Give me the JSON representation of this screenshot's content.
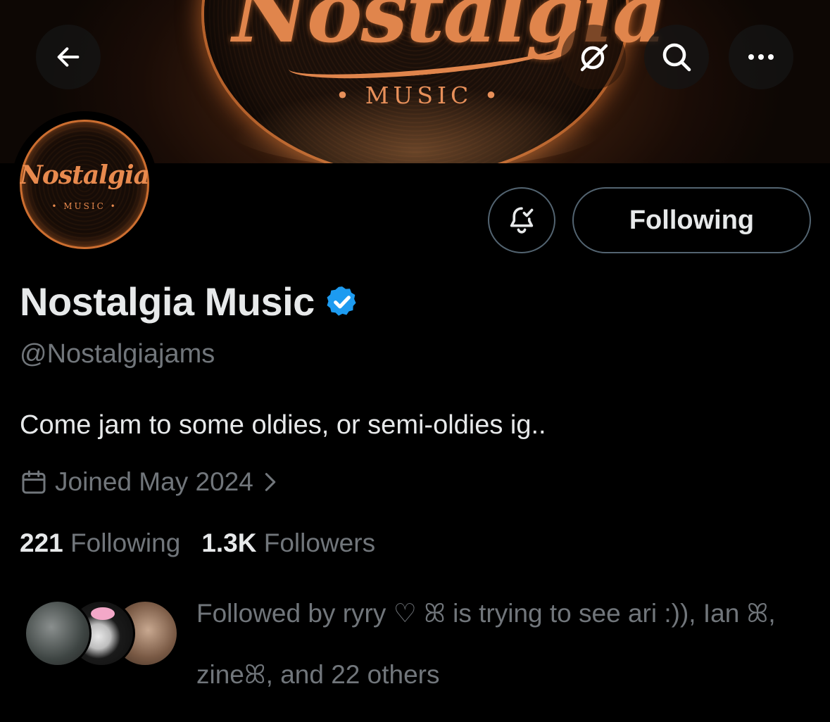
{
  "banner": {
    "logo_text": "Nostalgia",
    "sub_text": "• MUSIC •"
  },
  "nav": {
    "back_icon": "arrow-left-icon",
    "grok_icon": "grok-icon",
    "search_icon": "search-icon",
    "more_icon": "more-icon"
  },
  "avatar": {
    "logo_text": "Nostalgia",
    "sub_text": "• MUSIC •"
  },
  "actions": {
    "notify_icon": "bell-check-icon",
    "follow_label": "Following"
  },
  "profile": {
    "display_name": "Nostalgia Music",
    "verified_icon": "verified-badge-icon",
    "verified_color": "#1d9bf0",
    "handle": "@Nostalgiajams",
    "bio": "Come jam to some oldies, or semi-oldies ig..",
    "joined": "Joined May 2024",
    "joined_icon": "calendar-icon"
  },
  "stats": {
    "following_count": "221",
    "following_label": "Following",
    "followers_count": "1.3K",
    "followers_label": "Followers"
  },
  "followed_by": {
    "line1": "Followed by ryry ♡ ꕤ is trying to see ari :)), Ian ꕤ,",
    "line2": "zineꕤ, and 22 others"
  },
  "colors": {
    "background": "#000000",
    "text_primary": "#e7e9ea",
    "text_secondary": "#71767b",
    "border": "#536471",
    "brand_orange": "#e0854c"
  }
}
